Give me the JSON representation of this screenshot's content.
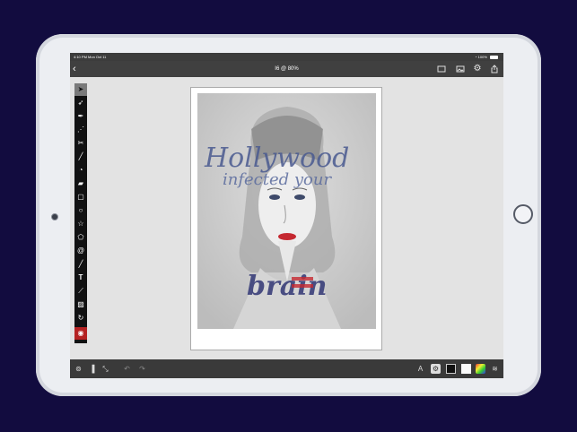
{
  "status_bar": {
    "time": "4:10 PM  Mon Oct 11",
    "battery": "100%"
  },
  "nav": {
    "back_icon": "chevron-left-icon",
    "title": "I6 @ 80%"
  },
  "artwork": {
    "line1": "Hollywood",
    "line2": "infected your",
    "line3": "brain"
  },
  "colors": {
    "background": "#120c3f",
    "toolbar": "#404040",
    "canvas": "#e3e3e3",
    "fill_tool": "#b52222"
  }
}
